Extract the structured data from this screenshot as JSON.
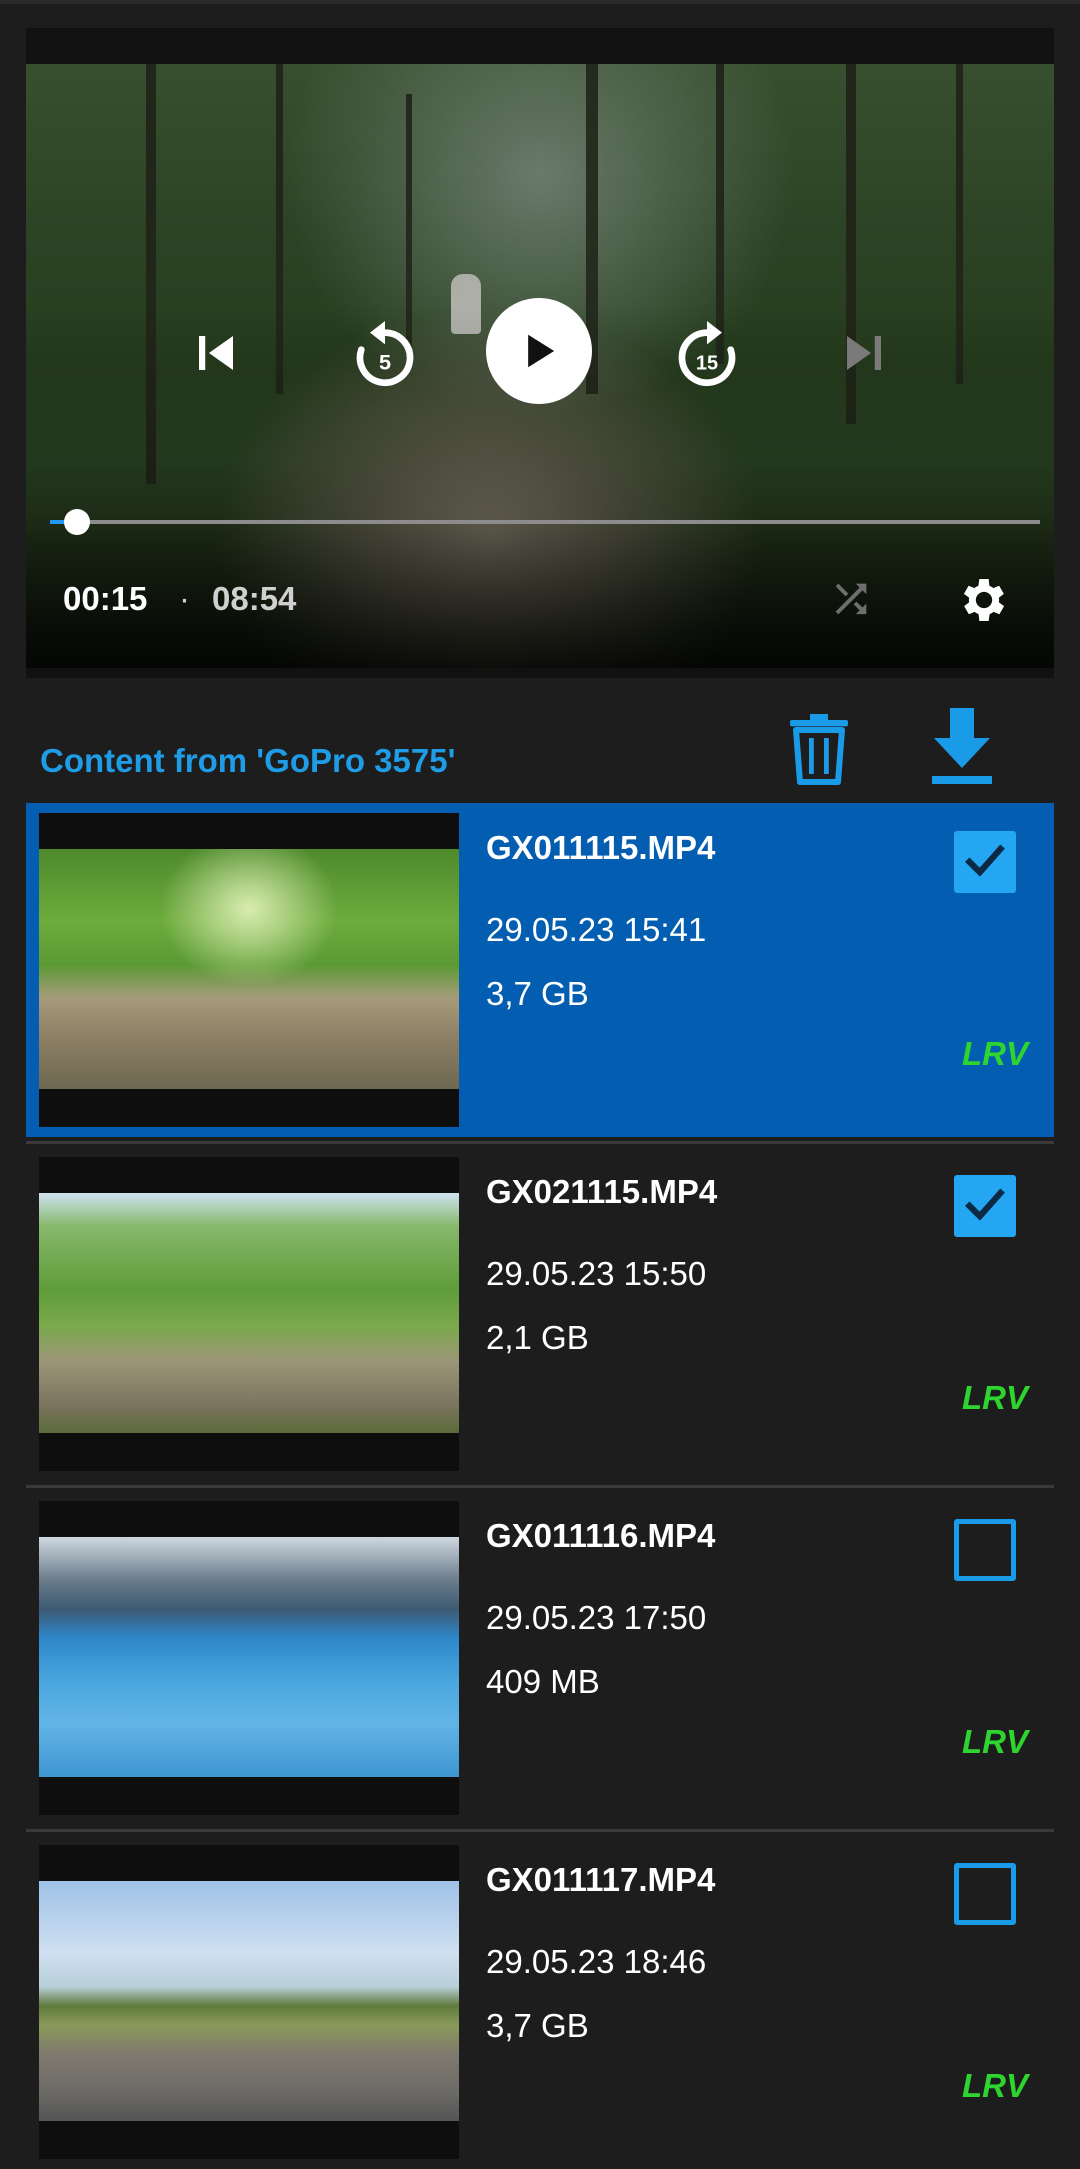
{
  "player": {
    "current_time": "00:15",
    "separator": "·",
    "duration": "08:54",
    "progress": 0.027,
    "controls": [
      "skip-previous-icon",
      "replay-5-icon",
      "play-icon",
      "forward-15-icon",
      "skip-next-icon",
      "shuffle-icon",
      "settings-icon"
    ],
    "replay_label": "5",
    "forward_label": "15"
  },
  "header": {
    "title": "Content from 'GoPro 3575'",
    "actions": [
      "delete-icon",
      "download-icon"
    ]
  },
  "media": [
    {
      "name": "GX011115.MP4",
      "date": "29.05.23 15:41",
      "size": "3,7 GB",
      "badge": "LRV",
      "checked": true,
      "selected": true
    },
    {
      "name": "GX021115.MP4",
      "date": "29.05.23 15:50",
      "size": "2,1 GB",
      "badge": "LRV",
      "checked": true,
      "selected": false
    },
    {
      "name": "GX011116.MP4",
      "date": "29.05.23 17:50",
      "size": "409 MB",
      "badge": "LRV",
      "checked": false,
      "selected": false
    },
    {
      "name": "GX011117.MP4",
      "date": "29.05.23 18:46",
      "size": "3,7 GB",
      "badge": "LRV",
      "checked": false,
      "selected": false
    }
  ],
  "colors": {
    "accent": "#1e9ce6",
    "selected_row": "#035db0",
    "badge": "#2ed52e",
    "background": "#1d1d1e"
  }
}
